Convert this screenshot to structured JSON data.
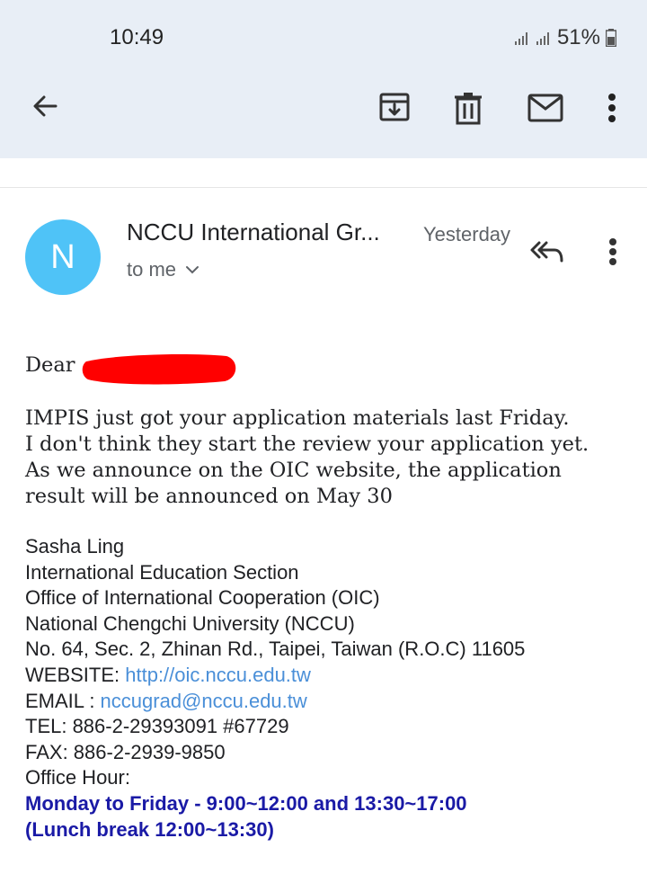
{
  "status_bar": {
    "time": "10:49",
    "battery": "51%"
  },
  "email": {
    "avatar_letter": "N",
    "sender": "NCCU International Gr...",
    "date": "Yesterday",
    "recipient": "to me",
    "greeting": "Dear",
    "body_lines": [
      "IMPIS just got your application materials last Friday.",
      "I don't think they start the review your application yet.",
      "As we announce on the OIC website, the application",
      "result will be announced on May 30"
    ],
    "signature": {
      "name": "Sasha Ling",
      "section": "International Education Section",
      "office": "Office of International Cooperation (OIC)",
      "university": "National Chengchi University (NCCU)",
      "address": "No. 64, Sec. 2, Zhinan Rd., Taipei, Taiwan (R.O.C) 11605",
      "website_label": "WEBSITE: ",
      "website_url": "http://oic.nccu.edu.tw",
      "email_label": "EMAIL : ",
      "email_addr": "nccugrad@nccu.edu.tw",
      "tel": "TEL: 886-2-29393091 #67729",
      "fax": "FAX: 886-2-2939-9850",
      "office_hour_label": "Office Hour:",
      "hours_line1": "Monday to Friday - 9:00~12:00 and 13:30~17:00",
      "hours_line2": "(Lunch break 12:00~13:30)"
    }
  },
  "icons": [
    "back-arrow-icon",
    "archive-icon",
    "delete-icon",
    "mark-unread-icon",
    "more-vert-icon",
    "reply-all-icon",
    "chevron-down-icon"
  ],
  "colors": {
    "appbar": "#e8eef6",
    "avatar": "#4fc3f7",
    "link": "#4a8fd8",
    "hours": "#1a1aa6",
    "redaction": "#ff0000"
  }
}
